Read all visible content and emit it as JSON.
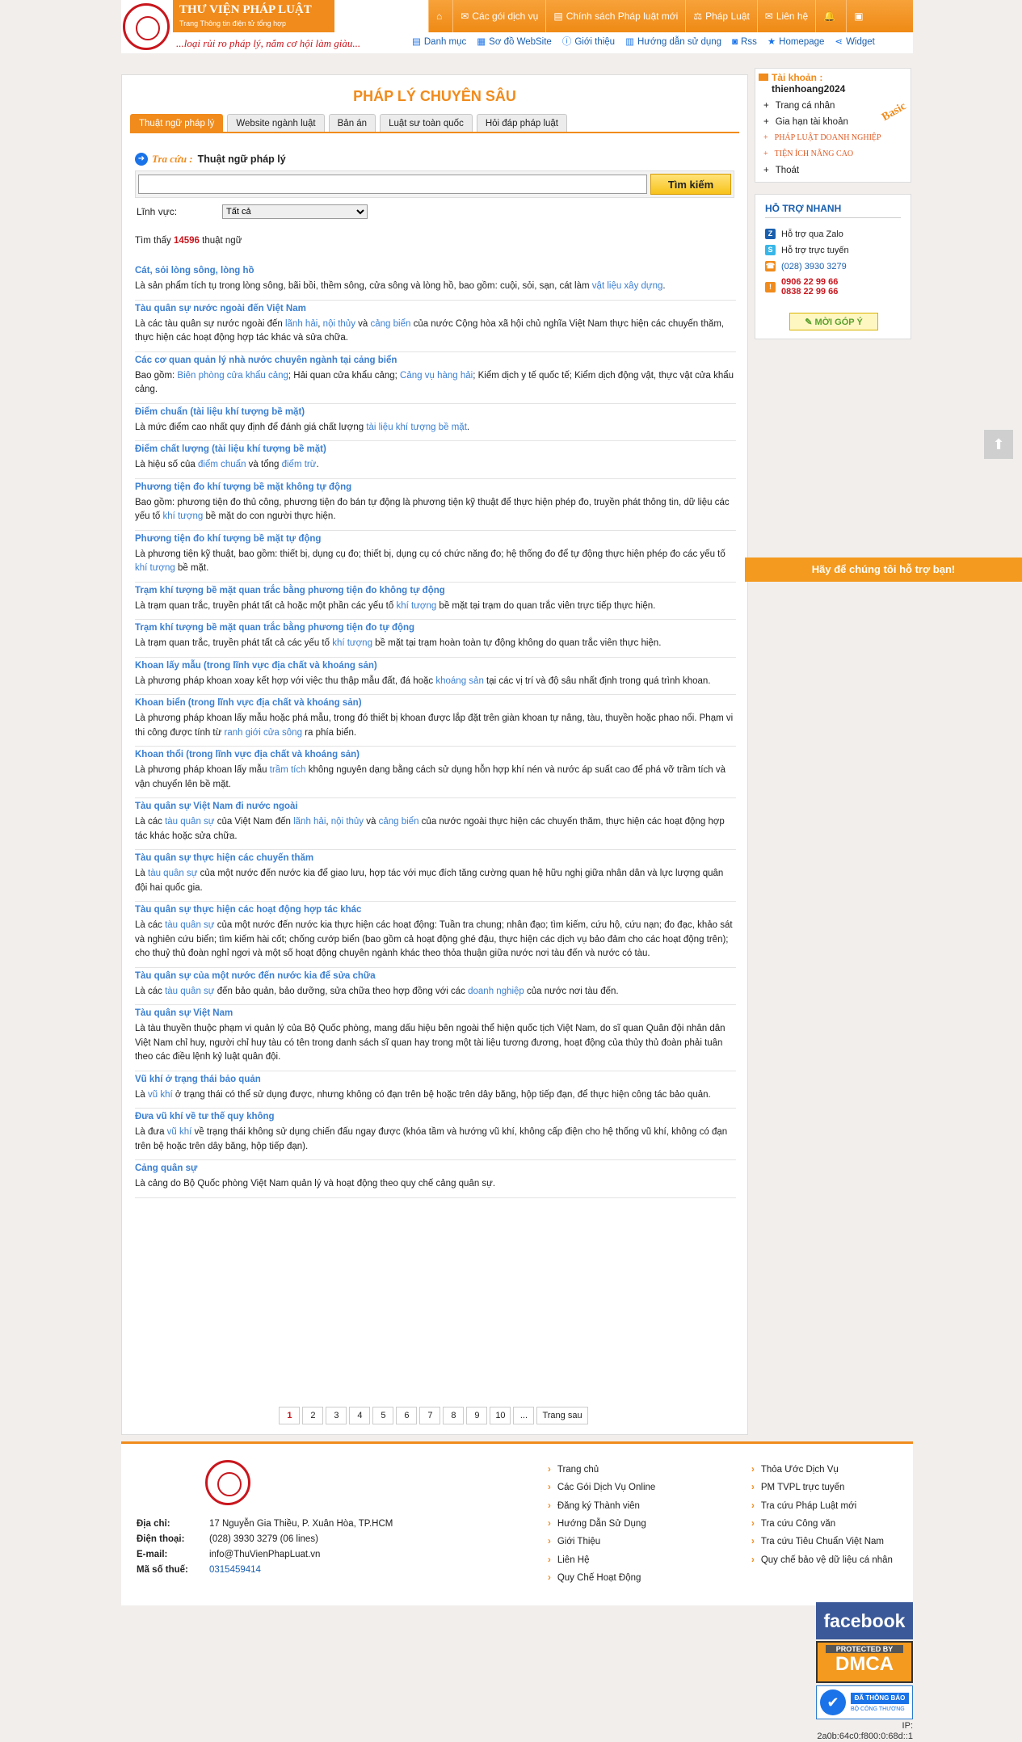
{
  "header": {
    "brand_title": "THƯ VIỆN PHÁP LUẬT",
    "brand_sub": "Trang Thông tin điện tử tổng hợp",
    "slogan": "...loại rủi ro pháp lý, nắm cơ hội làm giàu...",
    "topnav": [
      {
        "icon": "home-icon",
        "glyph": "⌂",
        "label": ""
      },
      {
        "icon": "gift-icon",
        "glyph": "✉",
        "label": "Các gói dịch vụ"
      },
      {
        "icon": "document-icon",
        "glyph": "▤",
        "label": "Chính sách Pháp luật mới"
      },
      {
        "icon": "gavel-icon",
        "glyph": "⚖",
        "label": "Pháp Luật"
      },
      {
        "icon": "mail-icon",
        "glyph": "✉",
        "label": "Liên hệ"
      },
      {
        "icon": "bell-icon",
        "glyph": "🔔",
        "label": ""
      },
      {
        "icon": "uk-flag-icon",
        "glyph": "▣",
        "label": ""
      }
    ],
    "subnav": [
      {
        "icon": "list-icon",
        "glyph": "▤",
        "label": "Danh mục"
      },
      {
        "icon": "sitemap-icon",
        "glyph": "▦",
        "label": "Sơ đồ WebSite"
      },
      {
        "icon": "info-icon",
        "glyph": "ⓘ",
        "label": "Giới thiệu"
      },
      {
        "icon": "book-icon",
        "glyph": "▥",
        "label": "Hướng dẫn sử dụng"
      },
      {
        "icon": "rss-icon",
        "glyph": "◙",
        "label": "Rss"
      },
      {
        "icon": "star-icon",
        "glyph": "★",
        "label": "Homepage"
      },
      {
        "icon": "share-icon",
        "glyph": "⋖",
        "label": "Widget"
      }
    ]
  },
  "main": {
    "title": "PHÁP LÝ CHUYÊN SÂU",
    "tabs": [
      {
        "label": "Thuật ngữ pháp lý",
        "active": true
      },
      {
        "label": "Website ngành luật",
        "active": false
      },
      {
        "label": "Bản án",
        "active": false
      },
      {
        "label": "Luật sư toàn quốc",
        "active": false
      },
      {
        "label": "Hỏi đáp pháp luật",
        "active": false
      }
    ],
    "search": {
      "label": "Tra cứu :",
      "sublabel": "Thuật ngữ pháp lý",
      "value": "",
      "placeholder": "",
      "button": "Tìm kiếm",
      "field_label": "Lĩnh vực:",
      "field_value": "Tất cả"
    },
    "found": {
      "prefix": "Tìm thấy",
      "count": "14596",
      "suffix": "thuật ngữ"
    },
    "results": [
      {
        "title": "Cát, sỏi lòng sông, lòng hồ",
        "parts": [
          [
            "Là sản phẩm tích tụ trong lòng sông, bãi bồi, thềm sông, cửa sông và lòng hồ, bao gồm: cuội, sỏi, sạn, cát làm ",
            false
          ],
          [
            "vật liệu xây dựng",
            true
          ],
          [
            ".",
            false
          ]
        ]
      },
      {
        "title": "Tàu quân sự nước ngoài đến Việt Nam",
        "parts": [
          [
            "Là các tàu quân sự nước ngoài đến ",
            false
          ],
          [
            "lãnh hải",
            true
          ],
          [
            ", ",
            false
          ],
          [
            "nội thủy",
            true
          ],
          [
            " và ",
            false
          ],
          [
            "cảng biển",
            true
          ],
          [
            " của nước Cộng hòa xã hội chủ nghĩa Việt Nam thực hiện các chuyến thăm, thực hiện các hoạt động hợp tác khác và sửa chữa.",
            false
          ]
        ]
      },
      {
        "title": "Các cơ quan quản lý nhà nước chuyên ngành tại cảng biển",
        "parts": [
          [
            "Bao gồm: ",
            false
          ],
          [
            "Biên phòng cửa khẩu cảng",
            true
          ],
          [
            "; Hải quan cửa khẩu cảng; ",
            false
          ],
          [
            "Cảng vụ hàng hải",
            true
          ],
          [
            "; Kiểm dịch y tế quốc tế; Kiểm dịch động vật, thực vật cửa khẩu cảng.",
            false
          ]
        ]
      },
      {
        "title": "Điểm chuẩn (tài liệu khí tượng bề mặt)",
        "parts": [
          [
            "Là mức điểm cao nhất quy định để đánh giá chất lượng ",
            false
          ],
          [
            "tài liệu khí tượng bề mặt",
            true
          ],
          [
            ".",
            false
          ]
        ]
      },
      {
        "title": "Điểm chất lượng (tài liệu khí tượng bề mặt)",
        "parts": [
          [
            "Là hiệu số của ",
            false
          ],
          [
            "điểm chuẩn",
            true
          ],
          [
            " và tổng ",
            false
          ],
          [
            "điểm trừ",
            true
          ],
          [
            ".",
            false
          ]
        ]
      },
      {
        "title": "Phương tiện đo khí tượng bề mặt không tự động",
        "parts": [
          [
            "Bao gồm: phương tiện đo thủ công, phương tiện đo bán tự động là phương tiện kỹ thuật để thực hiện phép đo, truyền phát thông tin, dữ liệu các yếu tố ",
            false
          ],
          [
            "khí tượng",
            true
          ],
          [
            " bề mặt do con người thực hiện.",
            false
          ]
        ]
      },
      {
        "title": "Phương tiện đo khí tượng bề mặt tự động",
        "parts": [
          [
            "Là phương tiện kỹ thuật, bao gồm: thiết bị, dụng cụ đo; thiết bị, dụng cụ có chức năng đo; hệ thống đo để tự động thực hiện phép đo các yếu tố ",
            false
          ],
          [
            "khí tượng",
            true
          ],
          [
            " bề mặt.",
            false
          ]
        ]
      },
      {
        "title": "Trạm khí tượng bề mặt quan trắc bằng phương tiện đo không tự động",
        "parts": [
          [
            "Là trạm quan trắc, truyền phát tất cả hoặc một phần các yếu tố ",
            false
          ],
          [
            "khí tượng",
            true
          ],
          [
            " bề mặt tại trạm do quan trắc viên trực tiếp thực hiện.",
            false
          ]
        ]
      },
      {
        "title": "Trạm khí tượng bề mặt quan trắc bằng phương tiện đo tự động",
        "parts": [
          [
            "Là trạm quan trắc, truyền phát tất cả các yếu tố ",
            false
          ],
          [
            "khí tượng",
            true
          ],
          [
            " bề mặt tại trạm hoàn toàn tự động không do quan trắc viên thực hiện.",
            false
          ]
        ]
      },
      {
        "title": "Khoan lấy mẫu (trong lĩnh vực địa chất và khoáng sản)",
        "parts": [
          [
            "Là phương pháp khoan xoay kết hợp với việc thu thập mẫu đất, đá hoặc ",
            false
          ],
          [
            "khoáng sản",
            true
          ],
          [
            " tại các vị trí và độ sâu nhất định trong quá trình khoan.",
            false
          ]
        ]
      },
      {
        "title": "Khoan biển (trong lĩnh vực địa chất và khoáng sản)",
        "parts": [
          [
            "Là phương pháp khoan lấy mẫu hoặc phá mẫu, trong đó thiết bị khoan được lắp đặt trên giàn khoan tự nâng, tàu, thuyền hoặc phao nổi. Phạm vi thi công được tính từ ",
            false
          ],
          [
            "ranh giới cửa sông",
            true
          ],
          [
            " ra phía biển.",
            false
          ]
        ]
      },
      {
        "title": "Khoan thổi (trong lĩnh vực địa chất và khoáng sản)",
        "parts": [
          [
            "Là phương pháp khoan lấy mẫu ",
            false
          ],
          [
            "trầm tích",
            true
          ],
          [
            " không nguyên dạng bằng cách sử dụng hỗn hợp khí nén và nước áp suất cao để phá vỡ trầm tích và vận chuyển lên bề mặt.",
            false
          ]
        ]
      },
      {
        "title": "Tàu quân sự Việt Nam đi nước ngoài",
        "parts": [
          [
            "Là các ",
            false
          ],
          [
            "tàu quân sự",
            true
          ],
          [
            " của Việt Nam đến ",
            false
          ],
          [
            "lãnh hải",
            true
          ],
          [
            ", ",
            false
          ],
          [
            "nội thủy",
            true
          ],
          [
            " và ",
            false
          ],
          [
            "cảng biển",
            true
          ],
          [
            " của nước ngoài thực hiện các chuyến thăm, thực hiện các hoạt động hợp tác khác hoặc sửa chữa.",
            false
          ]
        ]
      },
      {
        "title": "Tàu quân sự thực hiện các chuyến thăm",
        "parts": [
          [
            "Là ",
            false
          ],
          [
            "tàu quân sự",
            true
          ],
          [
            " của một nước đến nước kia để giao lưu, hợp tác với mục đích tăng cường quan hệ hữu nghị giữa nhân dân và lực lượng quân đội hai quốc gia.",
            false
          ]
        ]
      },
      {
        "title": "Tàu quân sự thực hiện các hoạt động hợp tác khác",
        "parts": [
          [
            "Là các ",
            false
          ],
          [
            "tàu quân sự",
            true
          ],
          [
            " của một nước đến nước kia thực hiện các hoạt động: Tuần tra chung; nhân đạo; tìm kiếm, cứu hộ, cứu nạn; đo đạc, khảo sát và nghiên cứu biển; tìm kiếm hài cốt; chống cướp biển (bao gồm cả hoạt động ghé đậu, thực hiện các dịch vụ bảo đảm cho các hoạt động trên); cho thuỷ thủ đoàn nghỉ ngơi và một số hoạt động chuyên ngành khác theo thỏa thuận giữa nước nơi tàu đến và nước có tàu.",
            false
          ]
        ]
      },
      {
        "title": "Tàu quân sự của một nước đến nước kia để sửa chữa",
        "parts": [
          [
            "Là các ",
            false
          ],
          [
            "tàu quân sự",
            true
          ],
          [
            " đến bảo quản, bảo dưỡng, sửa chữa theo hợp đồng với các ",
            false
          ],
          [
            "doanh nghiệp",
            true
          ],
          [
            " của nước nơi tàu đến.",
            false
          ]
        ]
      },
      {
        "title": "Tàu quân sự Việt Nam",
        "parts": [
          [
            "Là tàu thuyền thuộc phạm vi quản lý của Bộ Quốc phòng, mang dấu hiệu bên ngoài thể hiện quốc tịch Việt Nam, do sĩ quan Quân đội nhân dân Việt Nam chỉ huy, người chỉ huy tàu có tên trong danh sách sĩ quan hay trong một tài liệu tương đương, hoạt động của thủy thủ đoàn phải tuân theo các điều lệnh kỷ luật quân đội.",
            false
          ]
        ]
      },
      {
        "title": "Vũ khí ở trạng thái bảo quản",
        "parts": [
          [
            "Là ",
            false
          ],
          [
            "vũ khí",
            true
          ],
          [
            " ở trạng thái có thể sử dụng được, nhưng không có đạn trên bệ hoặc trên dây băng, hộp tiếp đạn, để thực hiện công tác bảo quản.",
            false
          ]
        ]
      },
      {
        "title": "Đưa vũ khí về tư thế quy không",
        "parts": [
          [
            "Là đưa ",
            false
          ],
          [
            "vũ khí",
            true
          ],
          [
            " về trạng thái không sử dụng chiến đấu ngay được (khóa tầm và hướng vũ khí, không cấp điện cho hệ thống vũ khí, không có đạn trên bệ hoặc trên dây băng, hộp tiếp đạn).",
            false
          ]
        ]
      },
      {
        "title": "Cảng quân sự",
        "parts": [
          [
            "Là cảng do Bộ Quốc phòng Việt Nam quản lý và hoạt động theo quy chế cảng quân sự.",
            false
          ]
        ]
      }
    ],
    "pager": {
      "pages": [
        "1",
        "2",
        "3",
        "4",
        "5",
        "6",
        "7",
        "8",
        "9",
        "10",
        "..."
      ],
      "current": "1",
      "next": "Trang sau"
    }
  },
  "account": {
    "heading": "Tài khoản :",
    "username": "thienhoang2024",
    "badge": "Basic",
    "items": [
      {
        "label": "Trang cá nhân",
        "red": false
      },
      {
        "label": "Gia hạn tài khoản",
        "red": false
      },
      {
        "label": "PHÁP LUẬT DOANH NGHIỆP",
        "red": true
      },
      {
        "label": "TIỆN ÍCH NÂNG CAO",
        "red": true
      },
      {
        "label": "Thoát",
        "red": false
      }
    ]
  },
  "support": {
    "heading": "HỖ TRỢ NHANH",
    "items": [
      {
        "icon": "zalo-icon",
        "glyph": "Z",
        "color": "#1a5fae",
        "text": "Hỗ trợ qua Zalo",
        "text2": "",
        "style": "plain"
      },
      {
        "icon": "skype-icon",
        "glyph": "S",
        "color": "#38b6e8",
        "text": "Hỗ trợ trực tuyến",
        "text2": "",
        "style": "plain"
      },
      {
        "icon": "phone-icon",
        "glyph": "☎",
        "color": "#f08b1c",
        "text": "(028) 3930 3279",
        "text2": "",
        "style": "blue"
      },
      {
        "icon": "mobile-icon",
        "glyph": "!",
        "color": "#f08b1c",
        "text": "0906 22 99 66",
        "text2": "0838 22 99 66",
        "style": "red"
      }
    ],
    "feedback": "MỜI GÓP Ý",
    "banner": "Hãy để chúng tôi hỗ trợ bạn!"
  },
  "footer": {
    "info": [
      {
        "k": "Địa chỉ:",
        "v": "17 Nguyễn Gia Thiều, P. Xuân Hòa, TP.HCM",
        "link": false
      },
      {
        "k": "Điện thoại:",
        "v": "(028) 3930 3279 (06 lines)",
        "link": false
      },
      {
        "k": "E-mail:",
        "v": "info@ThuVienPhapLuat.vn",
        "link": false
      },
      {
        "k": "Mã số thuế:",
        "v": "0315459414",
        "link": true
      }
    ],
    "col1": [
      "Trang chủ",
      "Các Gói Dịch Vụ Online",
      "Đăng ký Thành viên",
      "Hướng Dẫn Sử Dụng",
      "Giới Thiệu",
      "Liên Hệ",
      "Quy Chế Hoạt Động"
    ],
    "col2": [
      "Thỏa Ước Dịch Vụ",
      "PM TVPL trực tuyến",
      "Tra cứu Pháp Luật mới",
      "Tra cứu Công văn",
      "Tra cứu Tiêu Chuẩn Việt Nam",
      "Quy chế bảo vệ dữ liệu cá nhân"
    ],
    "badges": {
      "facebook": "facebook",
      "dmca_top": "PROTECTED BY",
      "dmca": "DMCA",
      "bct_top": "ĐÃ THÔNG BÁO",
      "bct_sub": "BỘ CÔNG THƯƠNG"
    },
    "ip_label": "IP:",
    "ip": "2a0b:64c0:f800:0:68d::1"
  }
}
